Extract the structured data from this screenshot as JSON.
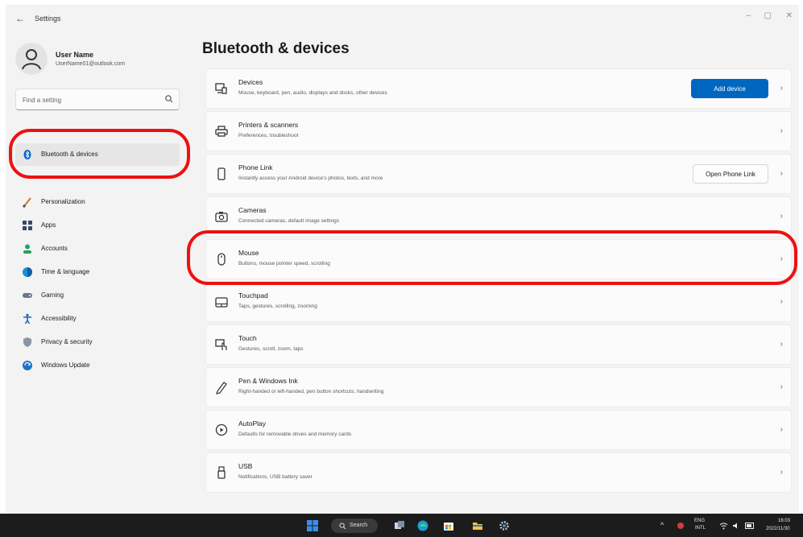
{
  "window": {
    "title": "Settings",
    "controls": {
      "minimize": "–",
      "maximize": "▢",
      "close": "✕"
    }
  },
  "profile": {
    "name": "User Name",
    "email": "UserName01@outlook.com"
  },
  "search": {
    "placeholder": "Find a setting"
  },
  "sidebar": {
    "items": [
      {
        "label": "Bluetooth & devices",
        "icon": "bluetooth-icon",
        "active": true
      },
      {
        "label": "Personalization",
        "icon": "brush-icon"
      },
      {
        "label": "Apps",
        "icon": "apps-icon"
      },
      {
        "label": "Accounts",
        "icon": "accounts-icon"
      },
      {
        "label": "Time & language",
        "icon": "globe-icon"
      },
      {
        "label": "Gaming",
        "icon": "gamepad-icon"
      },
      {
        "label": "Accessibility",
        "icon": "accessibility-icon"
      },
      {
        "label": "Privacy & security",
        "icon": "shield-icon"
      },
      {
        "label": "Windows Update",
        "icon": "update-icon"
      }
    ]
  },
  "main": {
    "title": "Bluetooth & devices",
    "cards": [
      {
        "title": "Devices",
        "subtitle": "Mouse, keyboard, pen, audio, displays and docks, other devices",
        "icon": "devices-icon",
        "button": "Add device"
      },
      {
        "title": "Printers & scanners",
        "subtitle": "Preferences, troubleshoot",
        "icon": "printer-icon"
      },
      {
        "title": "Phone Link",
        "subtitle": "Instantly access your Android device's photos, texts, and more",
        "icon": "phone-icon",
        "button": "Open Phone Link"
      },
      {
        "title": "Cameras",
        "subtitle": "Connected cameras, default image settings",
        "icon": "camera-icon"
      },
      {
        "title": "Mouse",
        "subtitle": "Buttons, mouse pointer speed, scrolling",
        "icon": "mouse-icon"
      },
      {
        "title": "Touchpad",
        "subtitle": "Taps, gestures, scrolling, zooming",
        "icon": "touchpad-icon"
      },
      {
        "title": "Touch",
        "subtitle": "Gestures, scroll, zoom, taps",
        "icon": "touch-icon"
      },
      {
        "title": "Pen & Windows Ink",
        "subtitle": "Right-handed or left-handed, pen button shortcuts, handwriting",
        "icon": "pen-icon"
      },
      {
        "title": "AutoPlay",
        "subtitle": "Defaults for removable drives and memory cards",
        "icon": "autoplay-icon"
      },
      {
        "title": "USB",
        "subtitle": "Notifications, USB battery saver",
        "icon": "usb-icon"
      }
    ]
  },
  "taskbar": {
    "search_label": "Search",
    "tray": {
      "language": "ENG",
      "language_sub": "INTL",
      "time": "16:03",
      "date": "2022/11/30"
    }
  },
  "colors": {
    "accent": "#0067c0",
    "highlight": "#ee1111",
    "taskbar": "#1c1c1c"
  }
}
